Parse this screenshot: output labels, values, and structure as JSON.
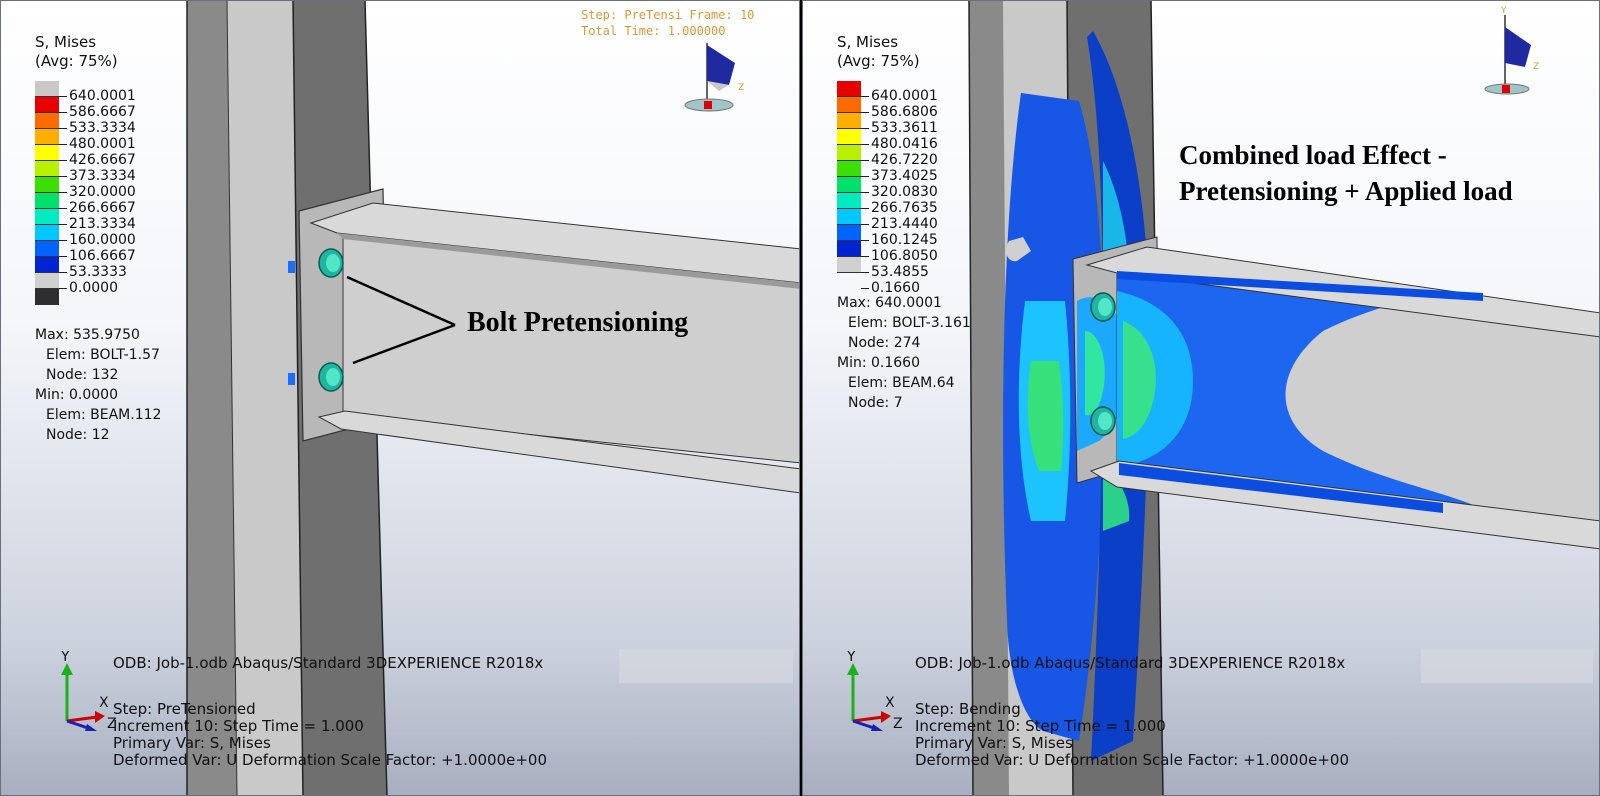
{
  "colors": {
    "legend": [
      "#c8c8c8",
      "#e60000",
      "#ff6a00",
      "#ffae00",
      "#ffff00",
      "#b8f000",
      "#3ce000",
      "#00e06a",
      "#00ecc0",
      "#00c8ff",
      "#0064ff",
      "#0023d2",
      "#d0d0d0",
      "#2e2e2e"
    ],
    "legend_right": [
      "#e60000",
      "#ff6a00",
      "#ffae00",
      "#ffff00",
      "#b8f000",
      "#3ce000",
      "#00e06a",
      "#00ecc0",
      "#00c8ff",
      "#0064ff",
      "#0023d2",
      "#d0d0d0"
    ]
  },
  "left": {
    "legend_title": "S, Mises",
    "legend_subtitle": "(Avg: 75%)",
    "legend_values": [
      "640.0001",
      "586.6667",
      "533.3334",
      "480.0001",
      "426.6667",
      "373.3334",
      "320.0000",
      "266.6667",
      "213.3334",
      "160.0000",
      "106.6667",
      "53.3333",
      "0.0000"
    ],
    "max_label": "Max: 535.9750",
    "max_elem": "Elem: BOLT-1.57",
    "max_node": "Node: 132",
    "min_label": "Min: 0.0000",
    "min_elem": "Elem: BEAM.112",
    "min_node": "Node: 12",
    "step_frame": "Step: PreTensi Frame: 10",
    "total_time": "Total Time: 1.000000",
    "annotation": "Bolt Pretensioning",
    "odb": "ODB: Job-1.odb    Abaqus/Standard 3DEXPERIENCE R2018x",
    "step": "Step: PreTensioned",
    "increment": "Increment     10: Step Time =      1.000",
    "primary_var": "Primary Var: S, Mises",
    "deformed_var": "Deformed Var: U   Deformation Scale Factor: +1.0000e+00"
  },
  "right": {
    "legend_title": "S, Mises",
    "legend_subtitle": "(Avg: 75%)",
    "legend_values": [
      "640.0001",
      "586.6806",
      "533.3611",
      "480.0416",
      "426.7220",
      "373.4025",
      "320.0830",
      "266.7635",
      "213.4440",
      "160.1245",
      "106.8050",
      "53.4855",
      "0.1660"
    ],
    "max_label": "Max: 640.0001",
    "max_elem": "Elem: BOLT-3.161",
    "max_node": "Node: 274",
    "min_label": "Min: 0.1660",
    "min_elem": "Elem: BEAM.64",
    "min_node": "Node: 7",
    "annotation_line1": "Combined load Effect -",
    "annotation_line2": "Pretensioning + Applied load",
    "odb": "ODB: Job-1.odb    Abaqus/Standard 3DEXPERIENCE R2018x",
    "step": "Step: Bending",
    "increment": "Increment     10: Step Time =      1.000",
    "primary_var": "Primary Var: S, Mises",
    "deformed_var": "Deformed Var: U   Deformation Scale Factor: +1.0000e+00"
  },
  "triad": {
    "y": "Y",
    "x": "X",
    "z": "Z"
  }
}
